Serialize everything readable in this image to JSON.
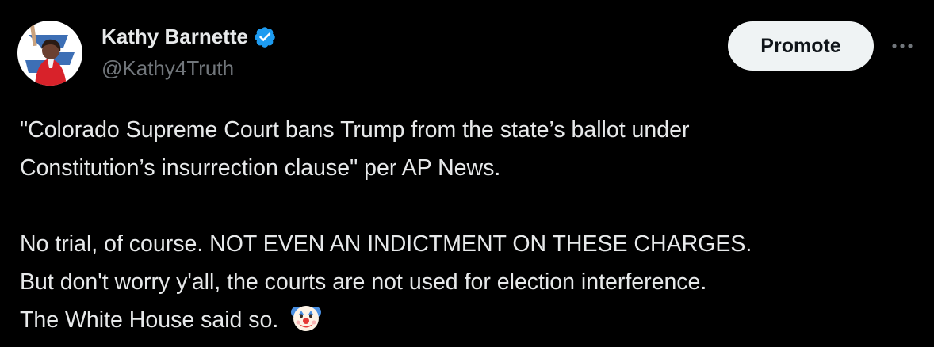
{
  "author": {
    "display_name": "Kathy Barnette",
    "handle": "@Kathy4Truth",
    "verified_icon": "verified-badge-icon"
  },
  "actions": {
    "promote_label": "Promote",
    "more_icon": "more-options-icon"
  },
  "tweet": {
    "paragraph1_lines": [
      "\"Colorado Supreme Court bans Trump from the state’s ballot under",
      "Constitution’s insurrection clause\" per AP News."
    ],
    "paragraph2_lines": [
      "No trial, of course. NOT EVEN AN INDICTMENT ON THESE CHARGES.",
      "But don't worry y'all, the courts are not used for election interference.",
      "The White House said so."
    ],
    "emoji": "clown-face-emoji"
  },
  "colors": {
    "background": "#000000",
    "text": "#e7e9ea",
    "secondary_text": "#71767b",
    "verified": "#1d9bf0",
    "promote_bg": "#eff3f4"
  }
}
